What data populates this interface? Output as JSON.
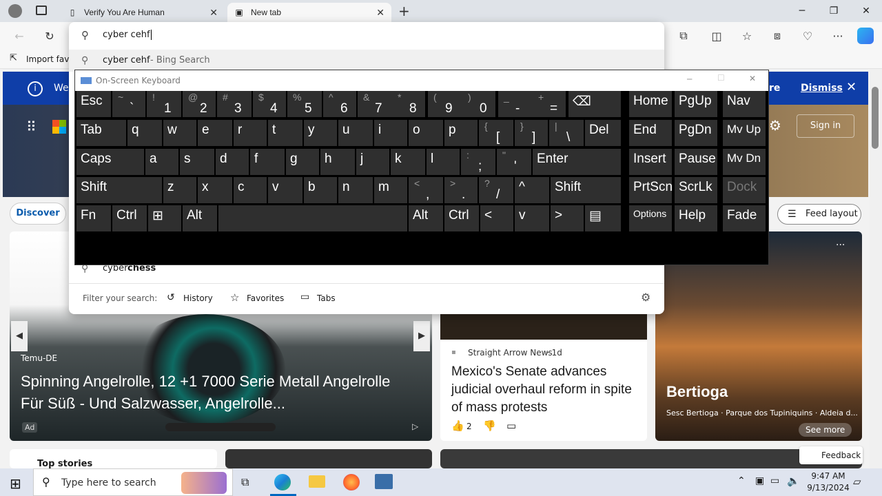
{
  "tabs": [
    {
      "title": "Verify You Are Human"
    },
    {
      "title": "New tab"
    }
  ],
  "address": {
    "value": "cyber cehf"
  },
  "favorites": {
    "import": "Import favo"
  },
  "suggestions": [
    {
      "text": "cyber cehf",
      "suffix": " - Bing Search"
    },
    {
      "text": "cyber ",
      "bold": "chess"
    }
  ],
  "filter": {
    "label": "Filter your search:",
    "history": "History",
    "favorites": "Favorites",
    "tabs": "Tabs"
  },
  "banner": {
    "text": "We'",
    "more": "re",
    "dismiss": "Dismiss"
  },
  "hero": {
    "signin": "Sign in"
  },
  "discover": {
    "label": "Discover",
    "feed": "Feed layout"
  },
  "ad": {
    "source": "Temu-DE",
    "title": "Spinning Angelrolle, 12 +1 7000 Serie Metall Angelrolle Für Süß - Und Salzwasser, Angelrolle...",
    "badge": "Ad"
  },
  "news": {
    "source": "Straight Arrow News",
    "age": "· 1d",
    "title": "Mexico's Senate advances judicial overhaul reform in spite of mass protests",
    "likes": "2"
  },
  "photo": {
    "title": "Bertioga",
    "caption": "Sesc Bertioga · Parque dos Tupiniquins · Aldeia d...",
    "see_more": "See more"
  },
  "bottom": {
    "top_stories": "Top stories",
    "feedback": "Feedback"
  },
  "osk": {
    "title": "On-Screen Keyboard",
    "row1": [
      {
        "m": "Esc"
      },
      {
        "s": "~",
        "l": "`"
      },
      {
        "s": "!",
        "l": "1"
      },
      {
        "s": "@",
        "l": "2"
      },
      {
        "s": "#",
        "l": "3"
      },
      {
        "s": "$",
        "l": "4"
      },
      {
        "s": "%",
        "l": "5"
      },
      {
        "s": "^",
        "l": "6"
      },
      {
        "s": "&",
        "l": "7"
      },
      {
        "s": "*",
        "l": "8"
      },
      {
        "s": "(",
        "l": "9"
      },
      {
        "s": ")",
        "l": "0"
      },
      {
        "s": "_",
        "l": "-"
      },
      {
        "s": "+",
        "l": "="
      },
      {
        "m": "⌫"
      }
    ],
    "row2": [
      {
        "m": "Tab"
      },
      {
        "m": "q"
      },
      {
        "m": "w"
      },
      {
        "m": "e"
      },
      {
        "m": "r"
      },
      {
        "m": "t"
      },
      {
        "m": "y"
      },
      {
        "m": "u"
      },
      {
        "m": "i"
      },
      {
        "m": "o"
      },
      {
        "m": "p"
      },
      {
        "s": "{",
        "l": "["
      },
      {
        "s": "}",
        "l": "]"
      },
      {
        "s": "|",
        "l": "\\"
      },
      {
        "m": "Del"
      }
    ],
    "row3": [
      {
        "m": "Caps"
      },
      {
        "m": "a"
      },
      {
        "m": "s"
      },
      {
        "m": "d"
      },
      {
        "m": "f"
      },
      {
        "m": "g"
      },
      {
        "m": "h"
      },
      {
        "m": "j"
      },
      {
        "m": "k"
      },
      {
        "m": "l"
      },
      {
        "s": ":",
        "l": ";"
      },
      {
        "s": "\"",
        "l": "'"
      },
      {
        "m": "Enter"
      }
    ],
    "row4": [
      {
        "m": "Shift"
      },
      {
        "m": "z"
      },
      {
        "m": "x"
      },
      {
        "m": "c"
      },
      {
        "m": "v"
      },
      {
        "m": "b"
      },
      {
        "m": "n"
      },
      {
        "m": "m"
      },
      {
        "s": "<",
        "l": ","
      },
      {
        "s": ">",
        "l": "."
      },
      {
        "s": "?",
        "l": "/"
      },
      {
        "m": "^"
      },
      {
        "m": "Shift"
      }
    ],
    "row5": [
      {
        "m": "Fn"
      },
      {
        "m": "Ctrl"
      },
      {
        "m": "⊞"
      },
      {
        "m": "Alt"
      },
      {
        "m": ""
      },
      {
        "m": "Alt"
      },
      {
        "m": "Ctrl"
      },
      {
        "m": "<"
      },
      {
        "m": "v"
      },
      {
        "m": ">"
      },
      {
        "m": "▤"
      }
    ],
    "nav": [
      "Home",
      "PgUp",
      "Nav",
      "End",
      "PgDn",
      "Mv Up",
      "Insert",
      "Pause",
      "Mv Dn",
      "PrtScn",
      "ScrLk",
      "Dock",
      "Options",
      "Help",
      "Fade"
    ]
  },
  "taskbar": {
    "search": "Type here to search",
    "time": "9:47 AM",
    "date": "9/13/2024"
  }
}
